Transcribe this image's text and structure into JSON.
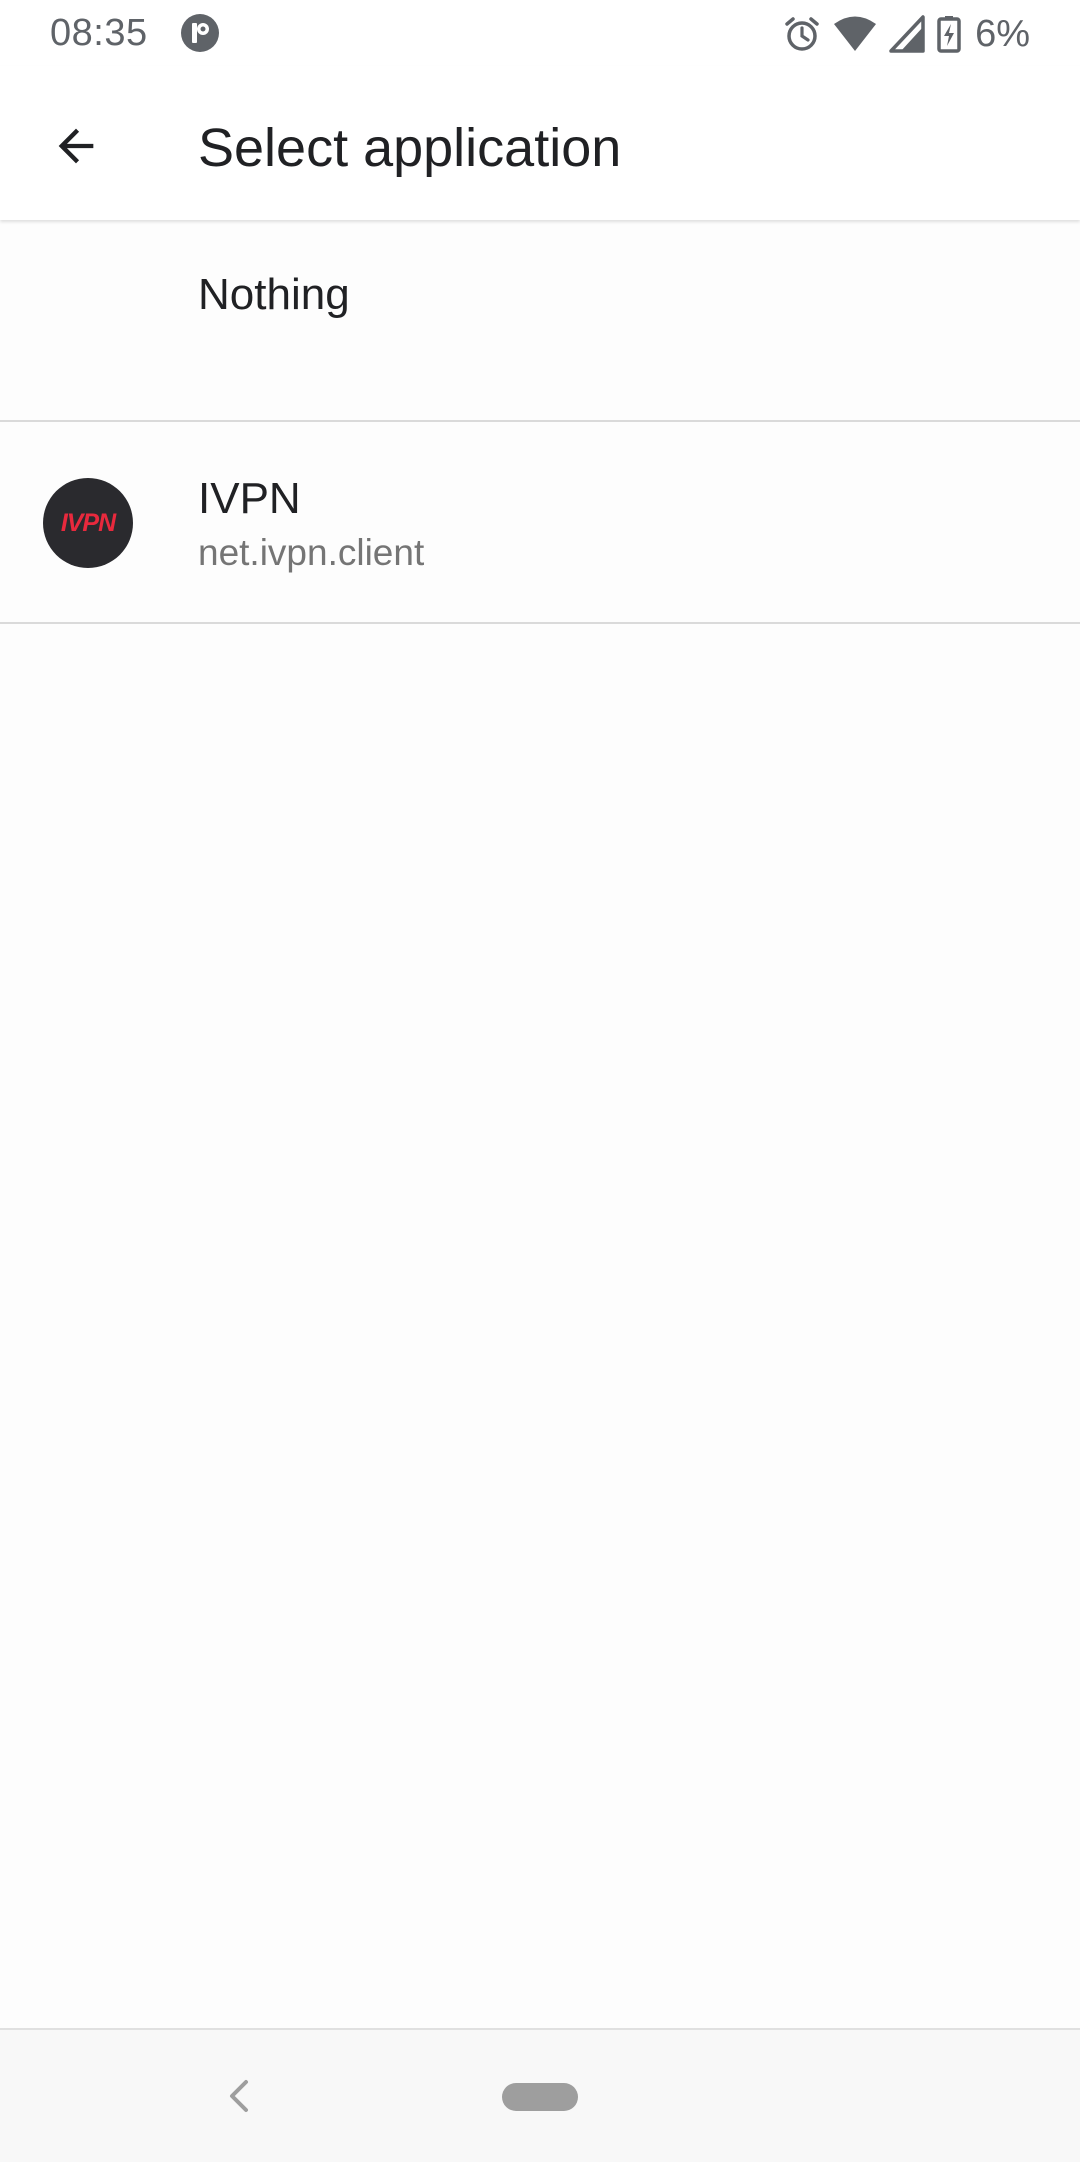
{
  "status_bar": {
    "time": "08:35",
    "battery_text": "6%",
    "icons": [
      "app-notification-icon",
      "alarm-icon",
      "wifi-icon",
      "cell-signal-icon",
      "battery-charging-icon"
    ]
  },
  "app_bar": {
    "title": "Select application",
    "back_icon": "arrow-back-icon"
  },
  "list": {
    "items": [
      {
        "title": "Nothing"
      },
      {
        "title": "IVPN",
        "subtitle": "net.ivpn.client",
        "logo_text": "IVPN",
        "logo_bg": "#2a2a2e",
        "logo_color": "#e8293d"
      }
    ]
  },
  "nav_bar": {
    "icons": [
      "nav-back-icon",
      "home-pill-icon"
    ]
  }
}
